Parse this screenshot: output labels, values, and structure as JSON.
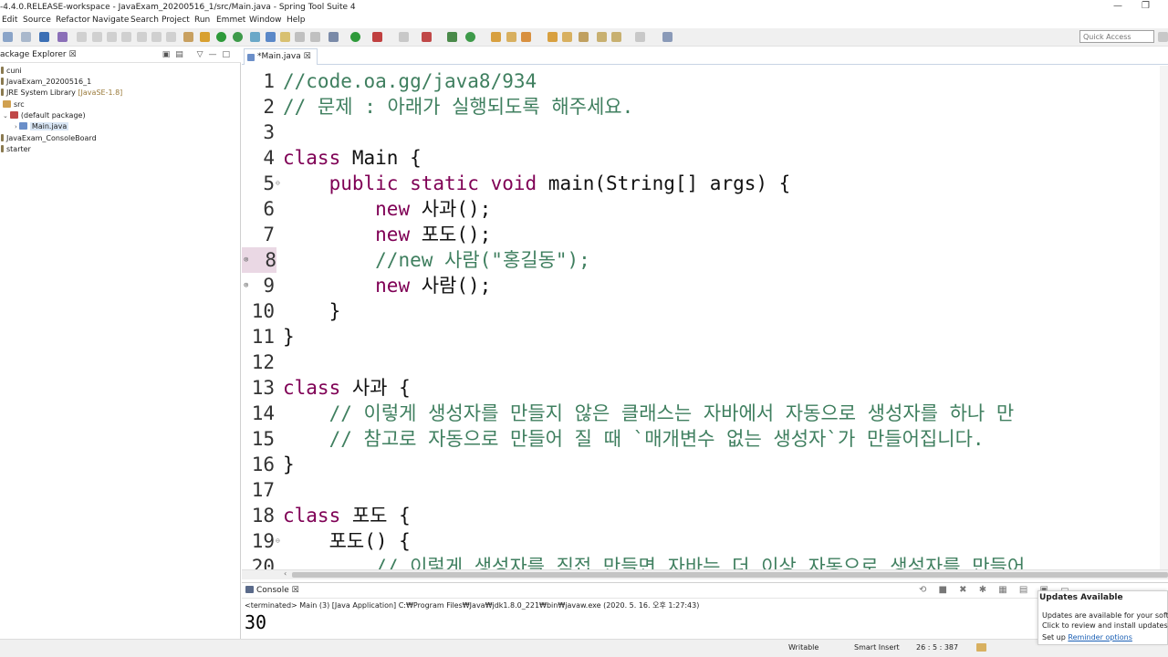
{
  "window": {
    "title": "-4.4.0.RELEASE-workspace - JavaExam_20200516_1/src/Main.java - Spring Tool Suite 4",
    "minimize_glyph": "—",
    "restore_glyph": "❐"
  },
  "menu": [
    "Edit",
    "Source",
    "Refactor",
    "Navigate",
    "Search",
    "Project",
    "Run",
    "Emmet",
    "Window",
    "Help"
  ],
  "toolbar": {
    "quick_access_placeholder": "Quick Access"
  },
  "package_explorer": {
    "tab_label": "ackage Explorer",
    "close_glyph": "☒",
    "tools": "▣▤ ▽—□",
    "items": [
      {
        "label": "cuni",
        "kind": "project"
      },
      {
        "label": "JavaExam_20200516_1",
        "kind": "project"
      },
      {
        "label": "JRE System Library",
        "suffix": "[JavaSE-1.8]",
        "kind": "library"
      },
      {
        "label": "src",
        "kind": "folder"
      },
      {
        "label": "(default package)",
        "kind": "package"
      },
      {
        "label": "Main.java",
        "kind": "file"
      },
      {
        "label": "JavaExam_ConsoleBoard",
        "kind": "project"
      },
      {
        "label": "starter",
        "kind": "project"
      }
    ]
  },
  "editor": {
    "tab_label": "*Main.java",
    "tab_close": "☒",
    "current_line": 8,
    "lines": [
      {
        "n": "1",
        "text": "//code.oa.gg/java8/934"
      },
      {
        "n": "2",
        "text": "// 문제 : 아래가 실행되도록 해주세요."
      },
      {
        "n": "3",
        "text": ""
      },
      {
        "n": "4",
        "kw": "class",
        "text": " Main {"
      },
      {
        "n": "5",
        "indent": "    ",
        "kw": "public static void",
        "text": " main(String[] args) {"
      },
      {
        "n": "6",
        "indent": "        ",
        "kw": "new",
        "text": " 사과();"
      },
      {
        "n": "7",
        "indent": "        ",
        "kw": "new",
        "text": " 포도();"
      },
      {
        "n": "8",
        "indent": "        ",
        "comment": "//new 사람(\"홍길동\");"
      },
      {
        "n": "9",
        "indent": "        ",
        "kw": "new",
        "text": " 사람();"
      },
      {
        "n": "10",
        "text": "    }"
      },
      {
        "n": "11",
        "text": "}"
      },
      {
        "n": "12",
        "text": ""
      },
      {
        "n": "13",
        "kw": "class",
        "text": " 사과 {"
      },
      {
        "n": "14",
        "indent": "    ",
        "comment": "// 이렇게 생성자를 만들지 않은 클래스는 자바에서 자동으로 생성자를 하나 만"
      },
      {
        "n": "15",
        "indent": "    ",
        "comment": "// 참고로 자동으로 만들어 질 때 `매개변수 없는 생성자`가 만들어집니다."
      },
      {
        "n": "16",
        "text": "}"
      },
      {
        "n": "17",
        "text": ""
      },
      {
        "n": "18",
        "kw": "class",
        "text": " 포도 {"
      },
      {
        "n": "19",
        "indent": "    ",
        "text": "포도() {"
      },
      {
        "n": "20",
        "indent": "        ",
        "comment": "// 이렇게 생성자를 직접 만들면 자바는 더 이상 자동으로 생성자를 만들어"
      }
    ]
  },
  "console": {
    "tab_label": "Console",
    "close_glyph": "☒",
    "tools": "⟲ ■ ✖ ✱ ▦ ▤ ▣ ▭",
    "status": "<terminated> Main (3) [Java Application] C:₩Program Files₩Java₩jdk1.8.0_221₩bin₩javaw.exe (2020. 5. 16. 오후 1:27:43)",
    "output": "30"
  },
  "statusbar": {
    "writable": "Writable",
    "insert_mode": "Smart Insert",
    "position": "26 : 5 : 387"
  },
  "updates_popup": {
    "title": "Updates Available",
    "line1": "Updates are available for your softwa",
    "line2": "Click to review and install updates.",
    "setup_prefix": "Set up",
    "setup_link": "Reminder options"
  },
  "colors": {
    "comment": "#3f7f5f",
    "keyword": "#7f0055",
    "current_line_gutter": "#ead8e4",
    "link": "#1a5fb4"
  },
  "icons": [
    "java-file-icon",
    "package-icon",
    "folder-icon",
    "library-icon",
    "project-icon",
    "error-marker-icon",
    "fold-icon"
  ]
}
